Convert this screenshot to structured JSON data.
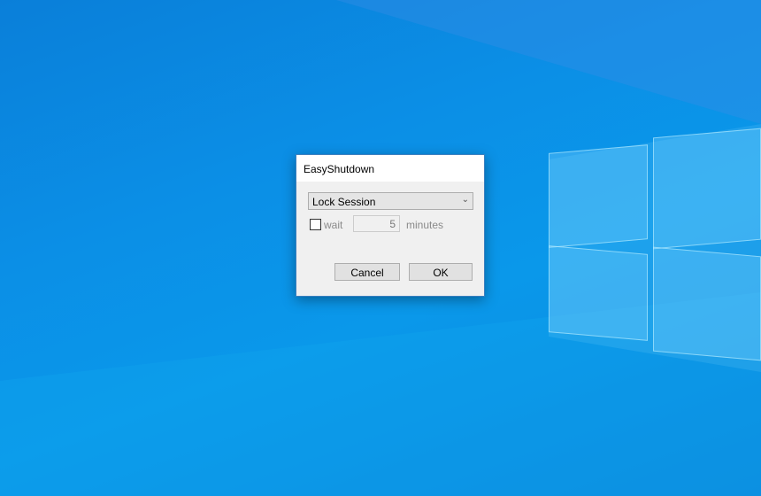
{
  "dialog": {
    "title": "EasyShutdown",
    "action_select": {
      "value": "Lock Session"
    },
    "wait_checkbox": {
      "label": "wait",
      "checked": false
    },
    "minutes_input": {
      "value": "5"
    },
    "minutes_label": "minutes",
    "cancel_label": "Cancel",
    "ok_label": "OK"
  }
}
